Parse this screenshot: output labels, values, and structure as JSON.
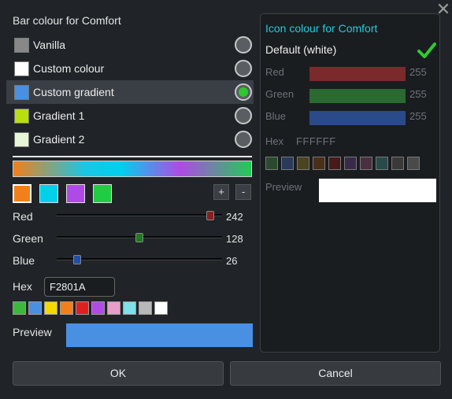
{
  "dialog": {
    "close_glyph": "✕"
  },
  "left": {
    "title": "Bar colour for Comfort",
    "options": [
      {
        "label": "Vanilla",
        "swatch": "#888888",
        "selected": false
      },
      {
        "label": "Custom colour",
        "swatch": "#ffffff",
        "selected": false
      },
      {
        "label": "Custom gradient",
        "swatch": "#4a90e2",
        "selected": true
      },
      {
        "label": "Gradient 1",
        "swatch": "#b8e011",
        "selected": false
      },
      {
        "label": "Gradient 2",
        "swatch": "#e6f7d8",
        "selected": false
      }
    ],
    "gradient_stops": [
      "#f2801a",
      "#00d0e8",
      "#b04ae6",
      "#1fcc44"
    ],
    "add_label": "+",
    "remove_label": "-",
    "sliders": [
      {
        "label": "Red",
        "value": "242",
        "color": "#8b1e1e"
      },
      {
        "label": "Green",
        "value": "128",
        "color": "#1e7a1e"
      },
      {
        "label": "Blue",
        "value": "26",
        "color": "#2250a8"
      }
    ],
    "hex_label": "Hex",
    "hex_value": "F2801A",
    "palette": [
      "#3db83d",
      "#4a90e2",
      "#f5d800",
      "#f2801a",
      "#e02020",
      "#b04ae6",
      "#e89ec8",
      "#7ee0ea",
      "#b8b8b8",
      "#ffffff"
    ],
    "preview_label": "Preview",
    "preview_color": "#4a90e2"
  },
  "right": {
    "title": "Icon colour for Comfort",
    "default_label": "Default (white)",
    "channels": [
      {
        "label": "Red",
        "value": "255",
        "bar_color": "#7a2a2a"
      },
      {
        "label": "Green",
        "value": "255",
        "bar_color": "#2a6a30"
      },
      {
        "label": "Blue",
        "value": "255",
        "bar_color": "#2a4a8a"
      }
    ],
    "hex_label": "Hex",
    "hex_value": "FFFFFF",
    "palette": [
      "#2a4a30",
      "#2a3a5a",
      "#4a4420",
      "#4a3018",
      "#4a1a1a",
      "#3a2a4a",
      "#4a3040",
      "#2a4a4a",
      "#3a3a3a",
      "#4a4a4a"
    ],
    "preview_label": "Preview",
    "preview_color": "#ffffff"
  },
  "footer": {
    "ok_label": "OK",
    "cancel_label": "Cancel"
  }
}
